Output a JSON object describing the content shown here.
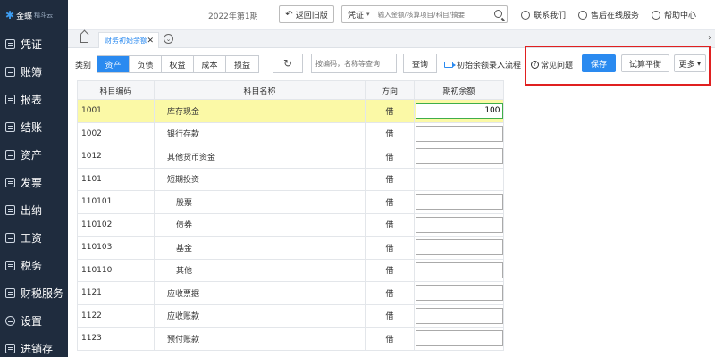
{
  "sidebar": {
    "logo": {
      "brand": "金蝶",
      "product": "精斗云"
    },
    "items": [
      {
        "label": "凭证",
        "icon": "voucher-icon"
      },
      {
        "label": "账簿",
        "icon": "ledger-icon"
      },
      {
        "label": "报表",
        "icon": "report-icon"
      },
      {
        "label": "结账",
        "icon": "close-account-icon"
      },
      {
        "label": "资产",
        "icon": "asset-icon"
      },
      {
        "label": "发票",
        "icon": "invoice-icon"
      },
      {
        "label": "出纳",
        "icon": "cashier-icon"
      },
      {
        "label": "工资",
        "icon": "salary-icon"
      },
      {
        "label": "税务",
        "icon": "tax-icon"
      },
      {
        "label": "财税服务",
        "icon": "tax-service-icon"
      },
      {
        "label": "设置",
        "icon": "settings-icon"
      },
      {
        "label": "进销存",
        "icon": "inventory-icon"
      }
    ]
  },
  "topbar": {
    "period": "2022年第1期",
    "back_old": "返回旧版",
    "search_type": "凭证",
    "search_placeholder": "输入金额/核算项目/科目/摘要",
    "contact": "联系我们",
    "service": "售后在线服务",
    "help": "帮助中心"
  },
  "tabs": {
    "active": "财务初始余额"
  },
  "toolbar": {
    "category_label": "类别",
    "categories": [
      "资产",
      "负债",
      "权益",
      "成本",
      "损益"
    ],
    "active_category": "资产",
    "code_placeholder": "按编码，名称等查询",
    "query": "查询",
    "flow": "初始余额录入流程",
    "faq": "常见问题",
    "save": "保存",
    "trial": "试算平衡",
    "more": "更多"
  },
  "table": {
    "headers": [
      "科目编码",
      "科目名称",
      "方向",
      "期初余额"
    ],
    "rows": [
      {
        "code": "1001",
        "name": "库存现金",
        "dir": "借",
        "balance": "100",
        "editable": true,
        "indent": false
      },
      {
        "code": "1002",
        "name": "银行存款",
        "dir": "借",
        "balance": "",
        "editable": true,
        "indent": false
      },
      {
        "code": "1012",
        "name": "其他货币资金",
        "dir": "借",
        "balance": "",
        "editable": true,
        "indent": false
      },
      {
        "code": "1101",
        "name": "短期投资",
        "dir": "借",
        "balance": "",
        "editable": false,
        "indent": false
      },
      {
        "code": "110101",
        "name": "股票",
        "dir": "借",
        "balance": "",
        "editable": true,
        "indent": true
      },
      {
        "code": "110102",
        "name": "债券",
        "dir": "借",
        "balance": "",
        "editable": true,
        "indent": true
      },
      {
        "code": "110103",
        "name": "基金",
        "dir": "借",
        "balance": "",
        "editable": true,
        "indent": true
      },
      {
        "code": "110110",
        "name": "其他",
        "dir": "借",
        "balance": "",
        "editable": true,
        "indent": true
      },
      {
        "code": "1121",
        "name": "应收票据",
        "dir": "借",
        "balance": "",
        "editable": true,
        "indent": false
      },
      {
        "code": "1122",
        "name": "应收账款",
        "dir": "借",
        "balance": "",
        "editable": true,
        "indent": false
      },
      {
        "code": "1123",
        "name": "预付账款",
        "dir": "借",
        "balance": "",
        "editable": true,
        "indent": false
      }
    ]
  },
  "colors": {
    "accent": "#2a8af0",
    "sidebar": "#1f2c3e",
    "highlight": "#e02020",
    "selected_row": "#fbf9a6"
  }
}
